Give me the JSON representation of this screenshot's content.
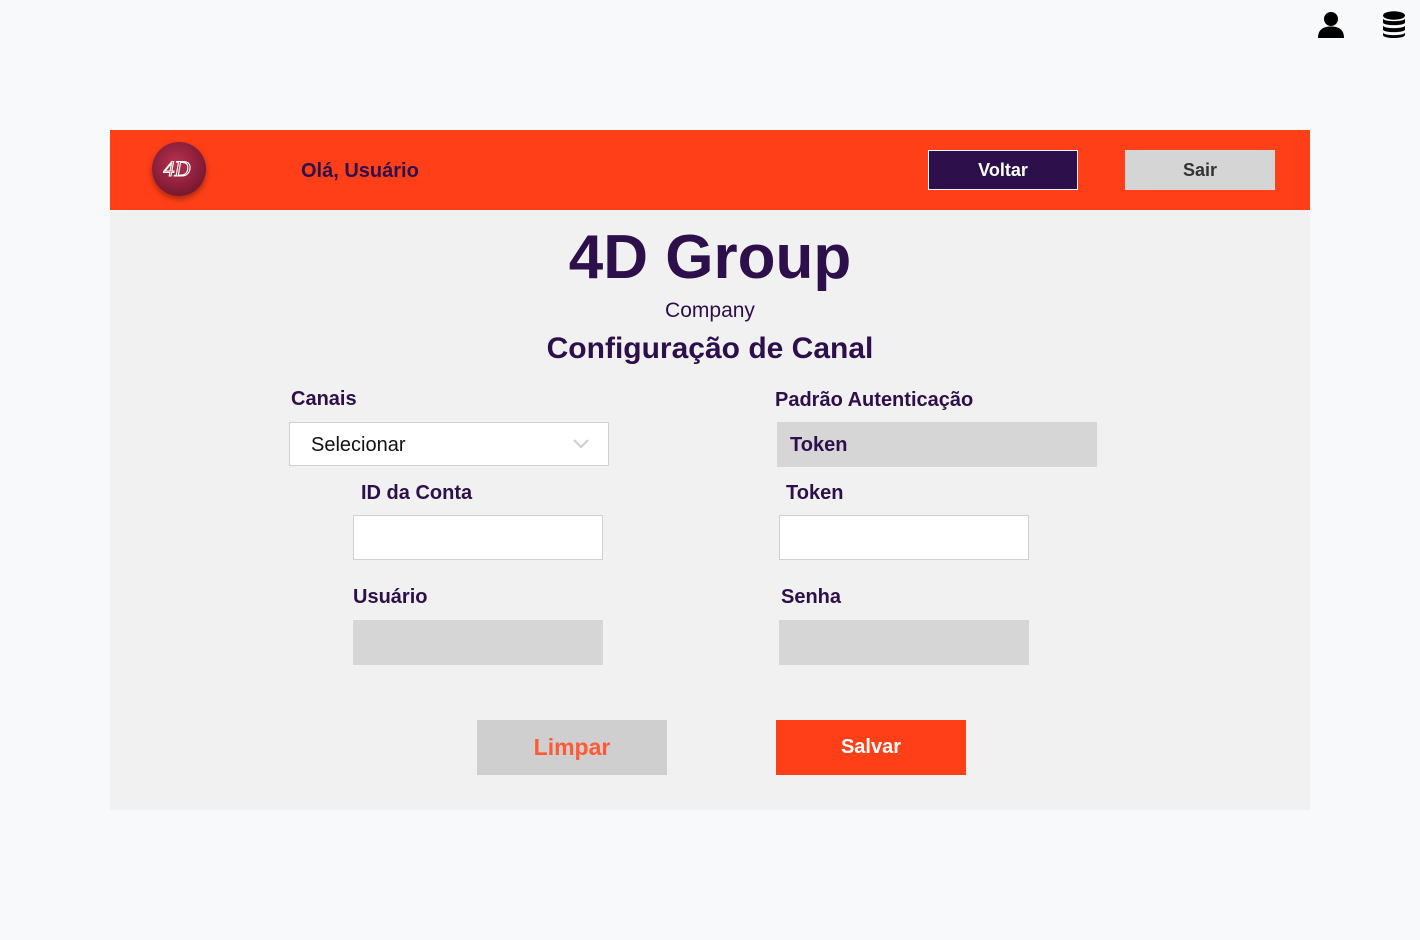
{
  "top_icons": {
    "user_icon": "user-icon",
    "database_icon": "database-icon"
  },
  "header": {
    "logo_text": "4D",
    "greeting": "Olá, Usuário",
    "back_label": "Voltar",
    "logout_label": "Sair"
  },
  "brand": {
    "name": "4D Group",
    "subtitle": "Company"
  },
  "page": {
    "title": "Configuração de Canal"
  },
  "form": {
    "channels": {
      "label": "Canais",
      "selected": "Selecionar"
    },
    "auth_standard": {
      "label": "Padrão Autenticação",
      "value": "Token"
    },
    "account_id": {
      "label": "ID da Conta",
      "value": ""
    },
    "token": {
      "label": "Token",
      "value": ""
    },
    "user": {
      "label": "Usuário",
      "value": ""
    },
    "password": {
      "label": "Senha",
      "value": ""
    }
  },
  "actions": {
    "clear_label": "Limpar",
    "save_label": "Salvar"
  },
  "colors": {
    "accent": "#ff3f17",
    "primary_dark": "#2d0f4c",
    "page_bg": "#f8f9fb",
    "card_bg": "#f1f1f1",
    "neutral_button": "#cfcfcf"
  }
}
